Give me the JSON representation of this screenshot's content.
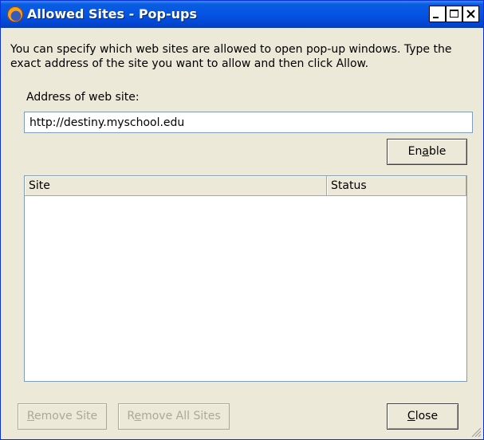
{
  "window": {
    "title": "Allowed Sites - Pop-ups",
    "icon": "firefox-icon"
  },
  "dialog": {
    "description": "You can specify which web sites are allowed to open pop-up windows. Type the exact address of the site you want to allow and then click Allow.",
    "address_label": "Address of web site:",
    "address_value": "http://destiny.myschool.edu",
    "enable_button": {
      "before": "En",
      "accel": "a",
      "after": "ble"
    }
  },
  "list": {
    "columns": [
      "Site",
      "Status"
    ],
    "rows": []
  },
  "footer": {
    "remove_site": {
      "accel": "R",
      "after": "emove Site"
    },
    "remove_all": {
      "before": "R",
      "accel": "e",
      "after": "move All Sites"
    },
    "close": {
      "accel": "C",
      "after": "lose"
    }
  }
}
